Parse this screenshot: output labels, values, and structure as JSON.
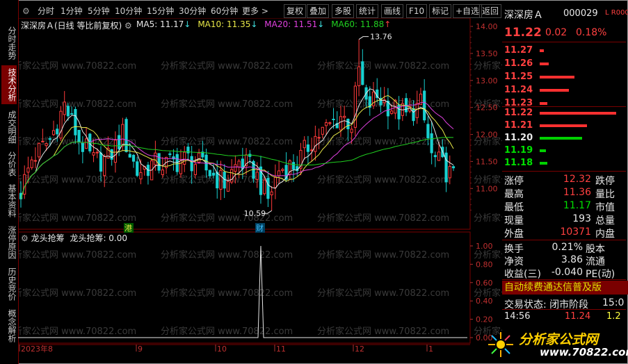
{
  "colors": {
    "up": "#ff3a3a",
    "down": "#18d0d0",
    "ma5": "#e8e8e8",
    "ma10": "#e8e848",
    "ma20": "#e040e0",
    "ma60": "#20d020",
    "accent": "#7a0000"
  },
  "left_tabs": [
    {
      "label": "分时走势",
      "active": false
    },
    {
      "label": "技术分析",
      "active": true
    },
    {
      "label": "成交明细",
      "active": false
    },
    {
      "label": "分价表",
      "active": false
    },
    {
      "label": "基本资料",
      "active": false
    },
    {
      "label": "涨停原因",
      "active": false
    },
    {
      "label": "历史竞价",
      "active": false
    },
    {
      "label": "概念解析",
      "active": false
    }
  ],
  "toolbar": {
    "settings_icon": "gear-icon",
    "periods": [
      "分时",
      "1分钟",
      "5分钟",
      "10分钟",
      "15分钟",
      "30分钟",
      "60分钟",
      "更多"
    ],
    "buttons": [
      "复权",
      "叠加",
      "多股",
      "统计",
      "画线",
      "F10",
      "标记",
      "+自选",
      "返回"
    ]
  },
  "chart": {
    "title": "深深房Ａ(日线 等比前复权)",
    "ma_legend": [
      {
        "label": "MA5: 11.17",
        "arrow": "↓",
        "color": "#e8e8e8"
      },
      {
        "label": "MA10: 11.35",
        "arrow": "↓",
        "color": "#e8e848"
      },
      {
        "label": "MA20: 11.51",
        "arrow": "↓",
        "color": "#e040e0"
      },
      {
        "label": "MA60: 11.88",
        "arrow": "↑",
        "color": "#20d020"
      }
    ],
    "y_ticks": [
      "14.00",
      "13.50",
      "13.00",
      "12.50",
      "12.00",
      "11.50",
      "11.00"
    ],
    "high_label": "13.76",
    "low_label": "10.59",
    "markers": [
      "港",
      "财"
    ],
    "x_ticks": [
      "2023年8",
      "9",
      "10",
      "11",
      "12",
      "1"
    ],
    "watermark": "分析家公式网 www.70822.com"
  },
  "indicator": {
    "name": "龙头抢筹",
    "legend": "龙头抢筹: 0.00",
    "y_ticks": [
      "1.00",
      "0.80",
      "0.60",
      "0.40",
      "0.20",
      "0.00"
    ]
  },
  "quote": {
    "name": "深深房Ａ",
    "code": "000029",
    "flags": "L R",
    "flag_num": "000",
    "price": "11.22",
    "change": "0.02",
    "pct": "0.18%"
  },
  "order_book": {
    "asks": [
      {
        "price": "11.27",
        "bar": 0.05
      },
      {
        "price": "11.26",
        "bar": 0.12
      },
      {
        "price": "11.25",
        "bar": 0.45
      },
      {
        "price": "11.24",
        "bar": 0.38
      },
      {
        "price": "11.23",
        "bar": 0.1
      }
    ],
    "bids": [
      {
        "price": "11.22",
        "bar": 1.0,
        "color": "red"
      },
      {
        "price": "11.21",
        "bar": 0.62,
        "color": "red"
      },
      {
        "price": "11.20",
        "bar": 0.55,
        "color": "green"
      },
      {
        "price": "11.19",
        "bar": 0.08,
        "color": "green"
      },
      {
        "price": "11.18",
        "bar": 0.1,
        "color": "green"
      }
    ]
  },
  "stats": [
    {
      "l": "涨停",
      "v": "12.32",
      "vc": "red",
      "r": "跌停"
    },
    {
      "l": "最高",
      "v": "11.36",
      "vc": "red",
      "r": "量比"
    },
    {
      "l": "最低",
      "v": "11.17",
      "vc": "green",
      "r": "市值"
    },
    {
      "l": "现量",
      "v": "193",
      "vc": "white",
      "r": "总量"
    },
    {
      "l": "外盘",
      "v": "10371",
      "vc": "red",
      "r": "内盘"
    }
  ],
  "stats2": [
    {
      "l": "换手",
      "v": "0.21%",
      "r": "股本"
    },
    {
      "l": "净资",
      "v": "3.86",
      "r": "流通"
    },
    {
      "l": "收益(三)",
      "v": "-0.040",
      "r": "PE(动)"
    }
  ],
  "banner": "自动续费通达信普及版",
  "status": {
    "label": "交易状态: 闭市阶段",
    "time": "15:0"
  },
  "tick": {
    "time": "14:56",
    "price": "11.24",
    "extra": "1.2"
  },
  "logo": {
    "text": "分析家公式网",
    "url": "www.70822.com"
  }
}
